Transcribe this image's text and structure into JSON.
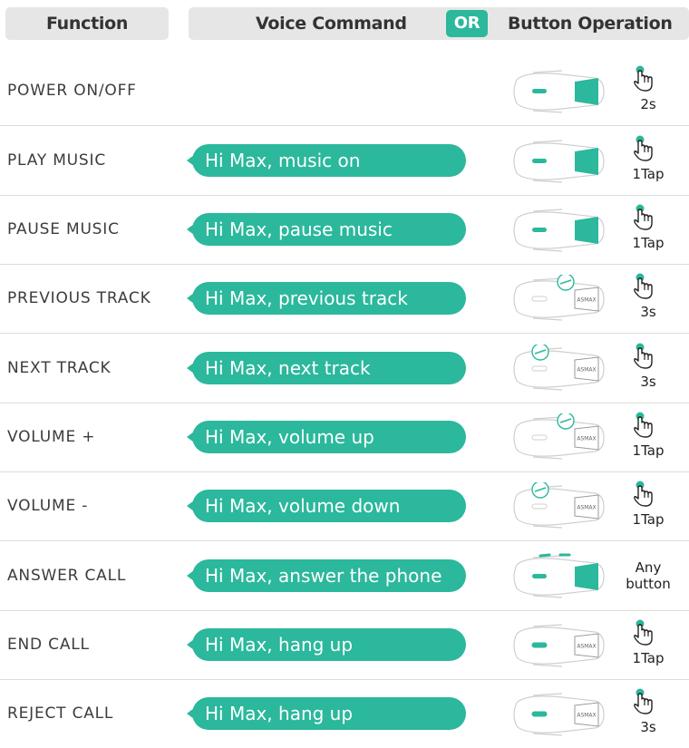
{
  "header": {
    "function": "Function",
    "voice": "Voice Command",
    "or": "OR",
    "button": "Button Operation"
  },
  "colors": {
    "accent": "#2bb89c",
    "header_bg": "#e6e6e6"
  },
  "rows": [
    {
      "function": "POWER ON/OFF",
      "voice": "",
      "device": "big-button",
      "gesture": "2s",
      "gesture_icon": "tap-hand-icon"
    },
    {
      "function": "PLAY MUSIC",
      "voice": "Hi Max, music on",
      "device": "big-button",
      "gesture": "1Tap",
      "gesture_icon": "tap-hand-icon"
    },
    {
      "function": "PAUSE MUSIC",
      "voice": "Hi Max, pause music",
      "device": "big-button",
      "gesture": "1Tap",
      "gesture_icon": "tap-hand-icon"
    },
    {
      "function": "PREVIOUS TRACK",
      "voice": "Hi Max, previous track",
      "device": "top-button-right",
      "gesture": "3s",
      "gesture_icon": "tap-hand-icon"
    },
    {
      "function": "NEXT TRACK",
      "voice": "Hi Max, next track",
      "device": "top-button-left",
      "gesture": "3s",
      "gesture_icon": "tap-hand-icon"
    },
    {
      "function": "VOLUME +",
      "voice": "Hi Max, volume up",
      "device": "top-button-right",
      "gesture": "1Tap",
      "gesture_icon": "tap-hand-icon"
    },
    {
      "function": "VOLUME -",
      "voice": "Hi Max, volume down",
      "device": "top-button-left",
      "gesture": "1Tap",
      "gesture_icon": "tap-hand-icon"
    },
    {
      "function": "ANSWER CALL",
      "voice": "Hi Max, answer the phone",
      "device": "all-buttons",
      "gesture": "Any button",
      "gesture_icon": ""
    },
    {
      "function": "END CALL",
      "voice": "Hi Max, hang up",
      "device": "logo-button",
      "gesture": "1Tap",
      "gesture_icon": "tap-hand-icon"
    },
    {
      "function": "REJECT CALL",
      "voice": "Hi Max, hang up",
      "device": "logo-button",
      "gesture": "3s",
      "gesture_icon": "tap-hand-icon"
    }
  ],
  "device_logo_text": "ASMAX"
}
